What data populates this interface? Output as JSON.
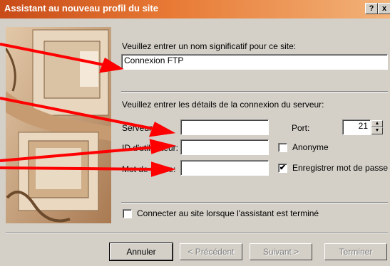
{
  "window": {
    "title": "Assistant au nouveau profil du site",
    "help_label": "?",
    "close_label": "x"
  },
  "site": {
    "name_prompt": "Veuillez entrer un nom significatif pour ce site:",
    "name_value": "Connexion FTP"
  },
  "connection": {
    "details_prompt": "Veuillez entrer les détails de la connexion du serveur:",
    "server_label": "Serveur:",
    "server_value": "",
    "port_label": "Port:",
    "port_value": "21",
    "user_label": "ID d'utilisateur:",
    "user_value": "",
    "anonymous_label": "Anonyme",
    "anonymous_checked": false,
    "password_label": "Mot de passe:",
    "password_value": "",
    "save_password_label": "Enregistrer mot de passe",
    "save_password_checked": true
  },
  "connect_on_finish": {
    "label": "Connecter au site lorsque l'assistant est terminé",
    "checked": false
  },
  "buttons": {
    "cancel": "Annuler",
    "previous": "< Précédent",
    "next": "Suivant >",
    "finish": "Terminer"
  },
  "colors": {
    "titlebar_start": "#c84b18",
    "titlebar_end": "#f2b37a",
    "annotation_arrow": "#ff0000",
    "dialog_bg": "#d4d0c8"
  },
  "icons": {
    "spin_up": "▲",
    "spin_down": "▼",
    "check": "✔"
  }
}
